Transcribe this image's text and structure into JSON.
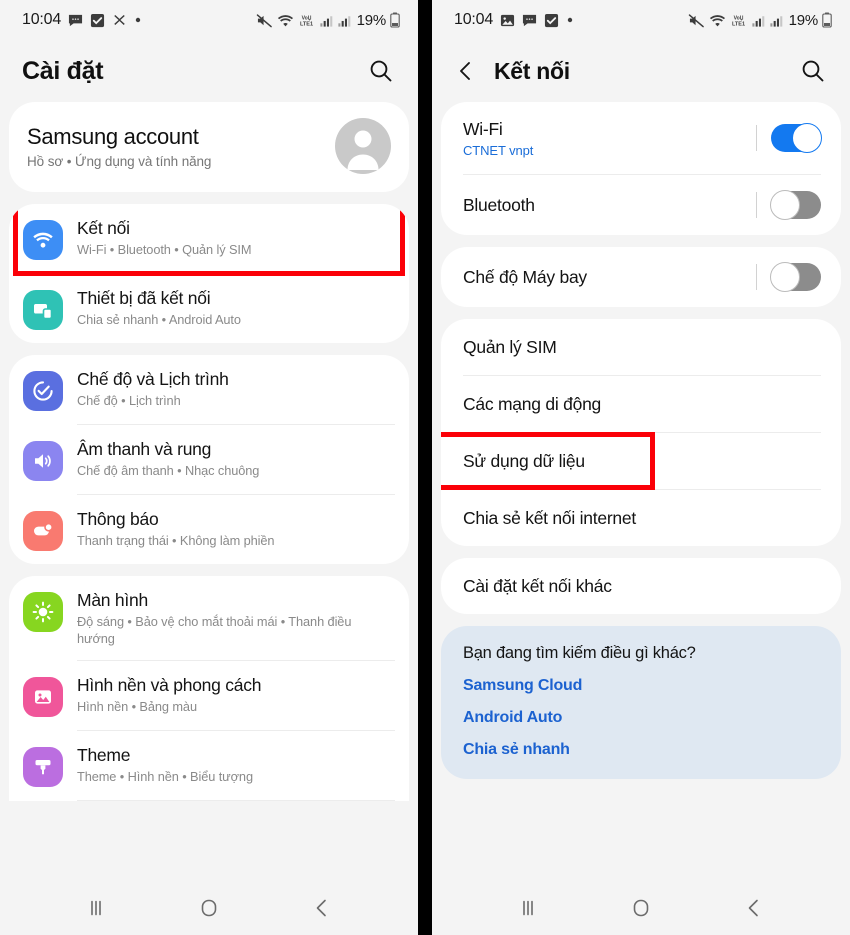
{
  "left": {
    "status_bar": {
      "clock": "10:04",
      "icons": [
        "message-icon",
        "checkbox-icon",
        "contacts-icon",
        "dot-icon"
      ],
      "right_icons": [
        "mute-icon",
        "wifi-icon",
        "volte-icon",
        "signal-icon-1",
        "signal-icon-2"
      ],
      "battery": "19%"
    },
    "header": {
      "title": "Cài đặt",
      "search_icon": "search-icon"
    },
    "account": {
      "title": "Samsung account",
      "subtitle": "Hồ sơ • Ứng dụng và tính năng",
      "avatar": "avatar-placeholder"
    },
    "groups": [
      {
        "items": [
          {
            "title": "Kết nối",
            "subtitle": "Wi-Fi • Bluetooth • Quản lý SIM",
            "icon": "wifi-icon",
            "icon_color": "#3d8ef5",
            "highlighted": true
          },
          {
            "title": "Thiết bị đã kết nối",
            "subtitle": "Chia sẻ nhanh • Android Auto",
            "icon": "devices-icon",
            "icon_color": "#2fc2b5",
            "highlighted": false
          }
        ]
      },
      {
        "items": [
          {
            "title": "Chế độ và Lịch trình",
            "subtitle": "Chế độ • Lịch trình",
            "icon": "modes-check-icon",
            "icon_color": "#5a6fe0",
            "highlighted": false
          },
          {
            "title": "Âm thanh và rung",
            "subtitle": "Chế độ âm thanh • Nhạc chuông",
            "icon": "sound-icon",
            "icon_color": "#8b85f0",
            "highlighted": false
          },
          {
            "title": "Thông báo",
            "subtitle": "Thanh trạng thái • Không làm phiền",
            "icon": "notification-icon",
            "icon_color": "#f97a70",
            "highlighted": false
          }
        ]
      },
      {
        "items": [
          {
            "title": "Màn hình",
            "subtitle": "Độ sáng • Bảo vệ cho mắt thoải mái • Thanh điều hướng",
            "icon": "brightness-icon",
            "icon_color": "#87d620",
            "highlighted": false
          },
          {
            "title": "Hình nền và phong cách",
            "subtitle": "Hình nền • Bảng màu",
            "icon": "wallpaper-icon",
            "icon_color": "#f0569a",
            "highlighted": false
          },
          {
            "title": "Theme",
            "subtitle": "Theme • Hình nền • Biểu tượng",
            "icon": "theme-brush-icon",
            "icon_color": "#bb6ee0",
            "highlighted": false
          }
        ]
      }
    ],
    "nav": [
      "recents-icon",
      "home-icon",
      "back-icon"
    ]
  },
  "right": {
    "status_bar": {
      "clock": "10:04",
      "icons": [
        "image-icon",
        "message-icon",
        "checkbox-icon",
        "dot-icon"
      ],
      "right_icons": [
        "mute-icon",
        "wifi-icon",
        "volte-icon",
        "signal-icon-1",
        "signal-icon-2"
      ],
      "battery": "19%"
    },
    "header": {
      "back_icon": "back-chevron-icon",
      "title": "Kết nối",
      "search_icon": "search-icon"
    },
    "groups": [
      {
        "items": [
          {
            "title": "Wi-Fi",
            "subtitle": "CTNET vnpt",
            "toggle": "on",
            "highlighted": false
          },
          {
            "title": "Bluetooth",
            "subtitle": "",
            "toggle": "off",
            "highlighted": false
          }
        ]
      },
      {
        "items": [
          {
            "title": "Chế độ Máy bay",
            "subtitle": "",
            "toggle": "off",
            "highlighted": false
          }
        ]
      },
      {
        "items": [
          {
            "title": "Quản lý SIM",
            "subtitle": "",
            "toggle": null,
            "highlighted": false
          },
          {
            "title": "Các mạng di động",
            "subtitle": "",
            "toggle": null,
            "highlighted": false
          },
          {
            "title": "Sử dụng dữ liệu",
            "subtitle": "",
            "toggle": null,
            "highlighted": true
          },
          {
            "title": "Chia sẻ kết nối internet",
            "subtitle": "",
            "toggle": null,
            "highlighted": false
          }
        ]
      },
      {
        "items": [
          {
            "title": "Cài đặt kết nối khác",
            "subtitle": "",
            "toggle": null,
            "highlighted": false
          }
        ]
      }
    ],
    "suggestions": {
      "title": "Bạn đang tìm kiếm điều gì khác?",
      "links": [
        "Samsung Cloud",
        "Android Auto",
        "Chia sẻ nhanh"
      ]
    },
    "nav": [
      "recents-icon",
      "home-icon",
      "back-icon"
    ]
  },
  "colors": {
    "highlight": "#fb0007",
    "toggle_on": "#1379f0",
    "toggle_off": "#8c8c8c",
    "link": "#1c62d0",
    "wifi_sub": "#1a6dd8",
    "suggestion_bg": "#dfe8f2"
  }
}
